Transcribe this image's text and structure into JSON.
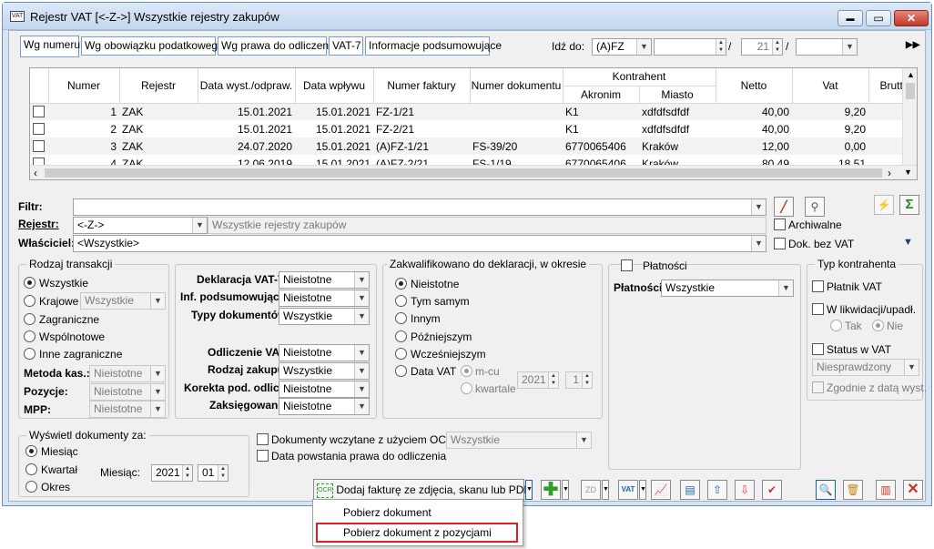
{
  "window": {
    "title": "Rejestr VAT  [<-Z->]  Wszystkie rejestry zakupów",
    "buttons": {
      "minimize": "▬",
      "maximize": "▭",
      "close": "✕"
    }
  },
  "tabs": [
    {
      "label": "Wg numeru"
    },
    {
      "label": "Wg obowiązku podatkowego"
    },
    {
      "label": "Wg prawa do odliczenia"
    },
    {
      "label": "VAT-7"
    },
    {
      "label": "Informacje podsumowujące"
    }
  ],
  "goto": {
    "label": "Idź do:",
    "value": "(A)FZ",
    "sep1": "/",
    "number": "21",
    "sep2": "/"
  },
  "table": {
    "group_header": "Kontrahent",
    "columns": [
      "Numer",
      "Rejestr",
      "Data wyst./odpraw.",
      "Data wpływu",
      "Numer faktury",
      "Numer dokumentu",
      "Akronim",
      "Miasto",
      "Netto",
      "Vat",
      "Brutto"
    ],
    "rows": [
      [
        "1",
        "ZAK",
        "15.01.2021",
        "15.01.2021",
        "FZ-1/21",
        "",
        "K1",
        "xdfdfsdfdf",
        "40,00",
        "9,20"
      ],
      [
        "2",
        "ZAK",
        "15.01.2021",
        "15.01.2021",
        "FZ-2/21",
        "",
        "K1",
        "xdfdfsdfdf",
        "40,00",
        "9,20"
      ],
      [
        "3",
        "ZAK",
        "24.07.2020",
        "15.01.2021",
        "(A)FZ-1/21",
        "FS-39/20",
        "6770065406",
        "Kraków",
        "12,00",
        "0,00"
      ],
      [
        "4",
        "ZAK",
        "12.06.2019",
        "15.01.2021",
        "(A)FZ-2/21",
        "FS-1/19",
        "6770065406",
        "Kraków",
        "80,49",
        "18,51"
      ]
    ]
  },
  "filters": {
    "filtr_label": "Filtr:",
    "rejestr_label": "Rejestr:",
    "rejestr_value": "<-Z->",
    "rejestr_desc": "Wszystkie rejestry zakupów",
    "wlasciciel_label": "Właściciel:",
    "wlasciciel_value": "<Wszystkie>",
    "archiwalne": "Archiwalne",
    "dok_bez_vat": "Dok. bez VAT"
  },
  "rodzaj_transakcji": {
    "title": "Rodzaj transakcji",
    "options": [
      "Wszystkie",
      "Krajowe",
      "Zagraniczne",
      "Wspólnotowe",
      "Inne zagraniczne"
    ],
    "krajowe_select": "Wszystkie",
    "metoda_kas_label": "Metoda kas.:",
    "metoda_kas_value": "Nieistotne",
    "pozycje_label": "Pozycje:",
    "pozycje_value": "Nieistotne",
    "mpp_label": "MPP:",
    "mpp_value": "Nieistotne"
  },
  "middle": {
    "deklaracja_label": "Deklaracja VAT-7:",
    "deklaracja_value": "Nieistotne",
    "inf_label": "Inf. podsumowujące:",
    "inf_value": "Nieistotne",
    "typy_label": "Typy dokumentów:",
    "typy_value": "Wszystkie",
    "odliczenie_label": "Odliczenie VAT:",
    "odliczenie_value": "Nieistotne",
    "rodzaj_label": "Rodzaj zakupu:",
    "rodzaj_value": "Wszystkie",
    "korekta_label": "Korekta pod. odlicz.:",
    "korekta_value": "Nieistotne",
    "zaksiegowano_label": "Zaksięgowano:",
    "zaksiegowano_value": "Nieistotne"
  },
  "zakwalifikowano": {
    "title": "Zakwalifikowano do deklaracji, w okresie",
    "options": [
      "Nieistotne",
      "Tym samym",
      "Innym",
      "Późniejszym",
      "Wcześniejszym",
      "Data VAT"
    ],
    "mcu": "m-cu",
    "kwartale": "kwartale",
    "year": "2021",
    "month": "1"
  },
  "platnosci": {
    "title": "Płatności",
    "label": "Płatności:",
    "value": "Wszystkie"
  },
  "typ_kontrahenta": {
    "title": "Typ kontrahenta",
    "platnik": "Płatnik VAT",
    "likwidacja": "W likwidacji/upadł.",
    "tak": "Tak",
    "nie": "Nie",
    "status": "Status w VAT",
    "status_value": "Niesprawdzony",
    "zgodnie": "Zgodnie z datą wyst."
  },
  "wyswietl": {
    "title": "Wyświetl dokumenty za:",
    "options": [
      "Miesiąc",
      "Kwartał",
      "Okres"
    ],
    "miesiac_label": "Miesiąc:",
    "year": "2021",
    "month": "01"
  },
  "ocr": {
    "checkbox_label": "Dokumenty wczytane z użyciem OCR",
    "select_value": "Wszystkie",
    "data_powstania": "Data powstania prawa do odliczenia"
  },
  "toolbar": {
    "ocr_button": "Dodaj fakturę ze zdjęcia, skanu lub PDF",
    "ocr_icon_text": "OCR",
    "vat_icon_text": "VAT",
    "zd_icon_text": "ZD"
  },
  "dropdown_menu": {
    "items": [
      "Pobierz dokument",
      "Pobierz dokument z pozycjami"
    ]
  },
  "colors": {
    "accent": "#1f5fa8",
    "highlight_border": "#e02020",
    "plus_green": "#2e9e2e",
    "sigma_green": "#1a8a1a",
    "close_red": "#c0392b"
  }
}
